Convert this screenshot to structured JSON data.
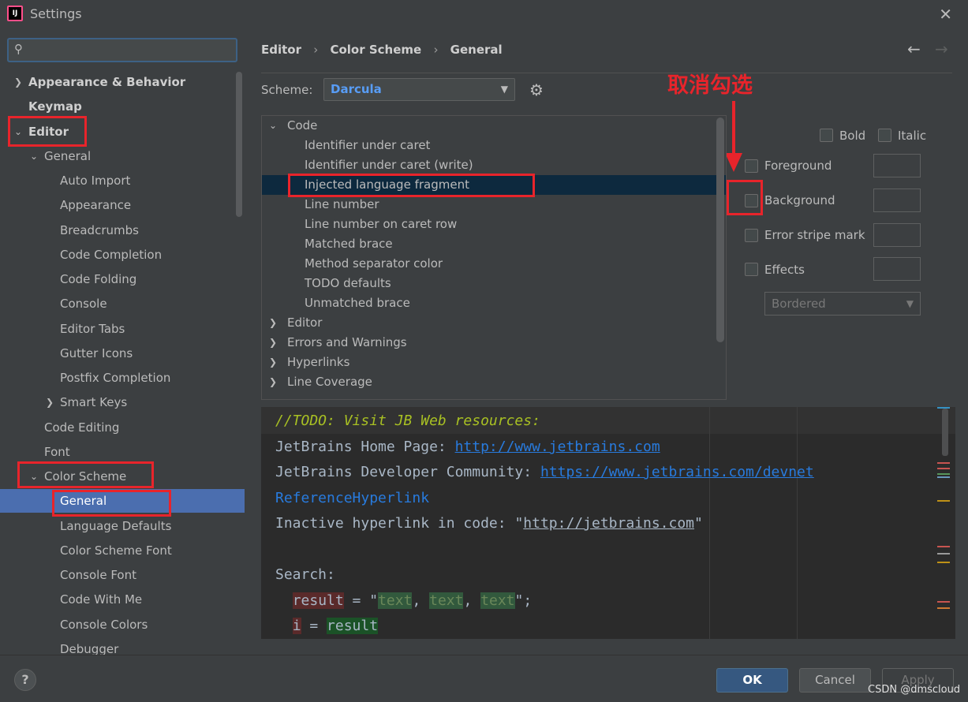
{
  "window": {
    "title": "Settings",
    "app_icon_text": "IJ"
  },
  "sidebar": {
    "search_placeholder": "",
    "items": [
      {
        "label": "Appearance & Behavior",
        "expand": "collapsed"
      },
      {
        "label": "Keymap",
        "expand": "none"
      },
      {
        "label": "Editor",
        "expand": "expanded"
      },
      {
        "label": "General",
        "expand": "expanded"
      },
      {
        "label": "Auto Import",
        "expand": "none"
      },
      {
        "label": "Appearance",
        "expand": "none"
      },
      {
        "label": "Breadcrumbs",
        "expand": "none"
      },
      {
        "label": "Code Completion",
        "expand": "none"
      },
      {
        "label": "Code Folding",
        "expand": "none"
      },
      {
        "label": "Console",
        "expand": "none"
      },
      {
        "label": "Editor Tabs",
        "expand": "none"
      },
      {
        "label": "Gutter Icons",
        "expand": "none"
      },
      {
        "label": "Postfix Completion",
        "expand": "none"
      },
      {
        "label": "Smart Keys",
        "expand": "collapsed"
      },
      {
        "label": "Code Editing",
        "expand": "none"
      },
      {
        "label": "Font",
        "expand": "none"
      },
      {
        "label": "Color Scheme",
        "expand": "expanded"
      },
      {
        "label": "General",
        "expand": "none",
        "selected": true
      },
      {
        "label": "Language Defaults",
        "expand": "none"
      },
      {
        "label": "Color Scheme Font",
        "expand": "none"
      },
      {
        "label": "Console Font",
        "expand": "none"
      },
      {
        "label": "Code With Me",
        "expand": "none"
      },
      {
        "label": "Console Colors",
        "expand": "none"
      },
      {
        "label": "Debugger",
        "expand": "none"
      }
    ]
  },
  "breadcrumb": [
    "Editor",
    "Color Scheme",
    "General"
  ],
  "breadcrumb_separator": "›",
  "scheme": {
    "label": "Scheme:",
    "value": "Darcula"
  },
  "annotation": {
    "text": "取消勾选",
    "color": "#e8242b"
  },
  "attributes_tree": [
    {
      "label": "Code",
      "expand": "expanded",
      "level": 0
    },
    {
      "label": "Identifier under caret",
      "level": 1
    },
    {
      "label": "Identifier under caret (write)",
      "level": 1
    },
    {
      "label": "Injected language fragment",
      "level": 1,
      "selected": true
    },
    {
      "label": "Line number",
      "level": 1
    },
    {
      "label": "Line number on caret row",
      "level": 1
    },
    {
      "label": "Matched brace",
      "level": 1
    },
    {
      "label": "Method separator color",
      "level": 1
    },
    {
      "label": "TODO defaults",
      "level": 1
    },
    {
      "label": "Unmatched brace",
      "level": 1
    },
    {
      "label": "Editor",
      "expand": "collapsed",
      "level": 0
    },
    {
      "label": "Errors and Warnings",
      "expand": "collapsed",
      "level": 0
    },
    {
      "label": "Hyperlinks",
      "expand": "collapsed",
      "level": 0
    },
    {
      "label": "Line Coverage",
      "expand": "collapsed",
      "level": 0
    }
  ],
  "effects": {
    "bold": "Bold",
    "italic": "Italic",
    "foreground": "Foreground",
    "background": "Background",
    "error_stripe": "Error stripe mark",
    "effects": "Effects",
    "effect_type": "Bordered"
  },
  "preview": {
    "todo": "//TODO: Visit JB Web resources:",
    "home_label": "JetBrains Home Page: ",
    "home_url": "http://www.jetbrains.com",
    "community_label": "JetBrains Developer Community: ",
    "community_url": "https://www.jetbrains.com/devnet",
    "ref_link": "ReferenceHyperlink",
    "inactive_label": "Inactive hyperlink in code: ",
    "inactive_quote_open": "\"",
    "inactive_url": "http://jetbrains.com",
    "inactive_quote_close": "\"",
    "search_label": "Search:",
    "search_line": {
      "var": "result",
      "eq": " = \"",
      "t1": "text",
      "c1": ", ",
      "t2": "text",
      "c2": ", ",
      "t3": "text",
      "end": "\";"
    },
    "i_line": {
      "var": "i",
      "eq": " = ",
      "val": "result"
    }
  },
  "footer": {
    "help": "?",
    "ok": "OK",
    "cancel": "Cancel",
    "apply": "Apply",
    "watermark": "CSDN @dmscloud"
  },
  "colors": {
    "accent_selection": "#4b6eaf",
    "highlight_box": "#e8242b",
    "ok_button": "#365880"
  }
}
